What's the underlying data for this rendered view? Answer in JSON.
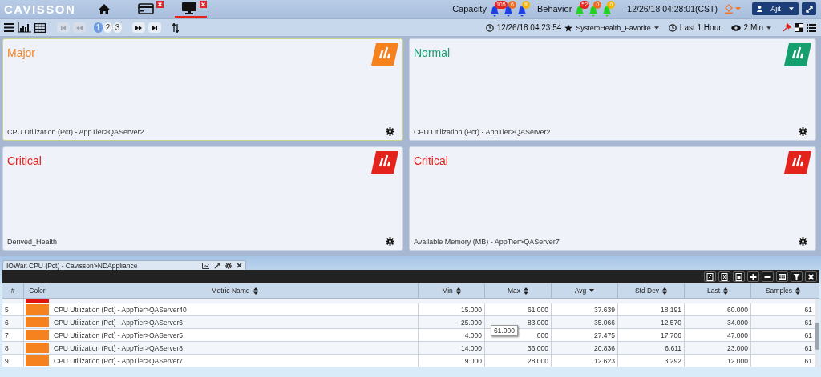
{
  "header": {
    "logo": "CAVISSON",
    "tabs": [
      {
        "kind": "home",
        "selected": false
      },
      {
        "kind": "card",
        "selected": false
      },
      {
        "kind": "monitor",
        "selected": true
      }
    ],
    "alerts": [
      {
        "label": "Capacity",
        "color": "#1f3fe6",
        "counts": [
          {
            "text": "105",
            "color": "#e5261f"
          },
          {
            "text": "6",
            "color": "#f26b1d"
          },
          {
            "text": "8",
            "color": "#f5b400"
          }
        ]
      },
      {
        "label": "Behavior",
        "color": "#22d422",
        "counts": [
          {
            "text": "52",
            "color": "#e5261f"
          },
          {
            "text": "0",
            "color": "#f26b1d"
          },
          {
            "text": "0",
            "color": "#f5b400"
          }
        ]
      }
    ],
    "datetime": "12/26/18 04:28:01(CST)",
    "user": "Ajit"
  },
  "toolbar": {
    "nav_back": [
      {
        "kind": "first",
        "disabled": true
      },
      {
        "kind": "prev",
        "disabled": true
      }
    ],
    "pages": [
      {
        "label": "1",
        "selected": true
      },
      {
        "label": "2",
        "selected": false
      },
      {
        "label": "3",
        "selected": false
      }
    ],
    "nav_forward": [
      {
        "kind": "next",
        "disabled": false
      },
      {
        "kind": "last",
        "disabled": false
      }
    ],
    "time": "12/26/18 04:23:54",
    "favorite": "SystemHealth_Favorite",
    "range": "Last 1 Hour",
    "interval": "2 Min"
  },
  "cards": [
    {
      "title": "Major",
      "color": "#f5821f",
      "metric": "CPU Utilization (Pct) - AppTier>QAServer2",
      "selected": true
    },
    {
      "title": "Normal",
      "color": "#159e6e",
      "metric": "CPU Utilization (Pct) - AppTier>QAServer2",
      "selected": false
    },
    {
      "title": "Critical",
      "color": "#e3231c",
      "metric": "Derived_Health",
      "selected": false
    },
    {
      "title": "Critical",
      "color": "#e3231c",
      "metric": "Available Memory (MB) - AppTier>QAServer7",
      "selected": false
    }
  ],
  "hidden_panel": {
    "title": "IOWait CPU (Pct) - Cavisson>NDAppliance"
  },
  "table": {
    "columns": [
      {
        "label": "#"
      },
      {
        "label": "Color"
      },
      {
        "label": "Metric Name",
        "sorted": false
      },
      {
        "label": "Min",
        "sorted": false
      },
      {
        "label": "Max",
        "sorted": false
      },
      {
        "label": "Avg",
        "sorted": true
      },
      {
        "label": "Std Dev",
        "sorted": false
      },
      {
        "label": "Last",
        "sorted": false
      },
      {
        "label": "Samples",
        "sorted": false
      }
    ],
    "rows": [
      {
        "kind": "partial",
        "color": "#e0140f"
      },
      {
        "kind": "row",
        "color": "#f5821f",
        "cells": [
          "5",
          "CPU Utilization (Pct) - AppTier>QAServer40",
          "15.000",
          "61.000",
          "37.639",
          "18.191",
          "60.000",
          "61"
        ]
      },
      {
        "kind": "row",
        "color": "#f5821f",
        "cells": [
          "6",
          "CPU Utilization (Pct) - AppTier>QAServer6",
          "25.000",
          "83.000",
          "35.066",
          "12.570",
          "34.000",
          "61"
        ]
      },
      {
        "kind": "row",
        "color": "#f5821f",
        "cells": [
          "7",
          "CPU Utilization (Pct) - AppTier>QAServer5",
          "4.000",
          ".000",
          "27.475",
          "17.706",
          "47.000",
          "61"
        ]
      },
      {
        "kind": "row",
        "color": "#f5821f",
        "cells": [
          "8",
          "CPU Utilization (Pct) - AppTier>QAServer8",
          "14.000",
          "36.000",
          "20.836",
          "6.611",
          "23.000",
          "61"
        ]
      },
      {
        "kind": "row",
        "color": "#f5821f",
        "cells": [
          "9",
          "CPU Utilization (Pct) - AppTier>QAServer7",
          "9.000",
          "28.000",
          "12.623",
          "3.292",
          "12.000",
          "61"
        ]
      }
    ],
    "tooltip": {
      "text": "61.000"
    }
  }
}
